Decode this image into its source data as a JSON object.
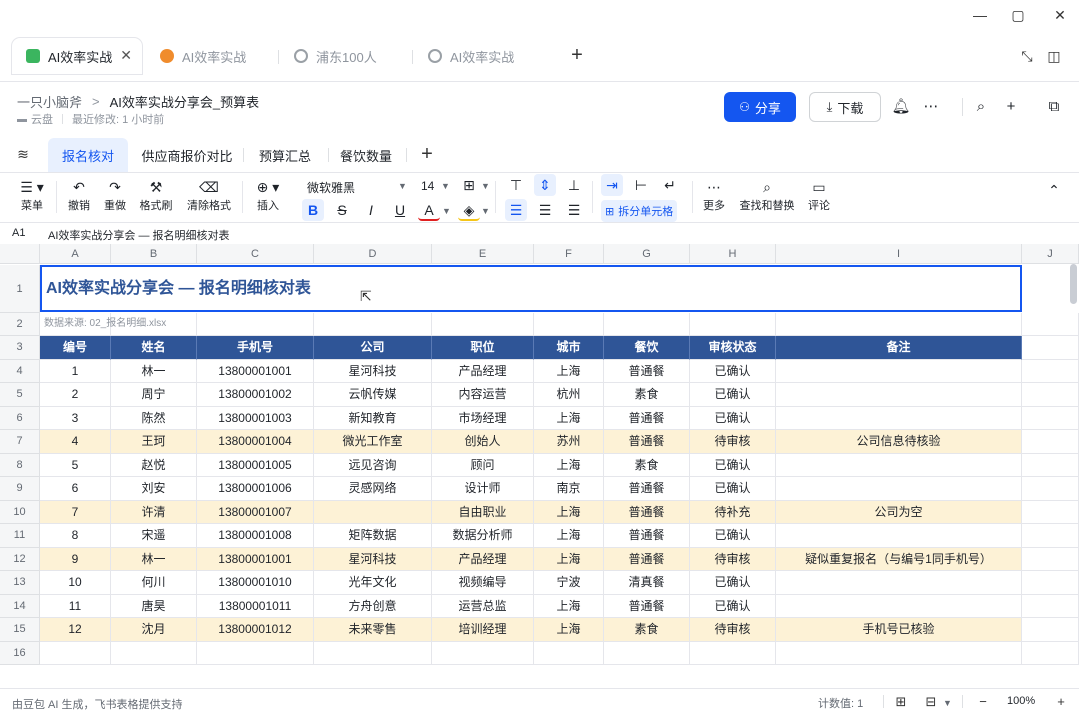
{
  "window": {
    "minimize_icon": "—",
    "maximize_icon": "▢",
    "close_icon": "✕"
  },
  "browser_tabs": [
    {
      "label": "AI效率实战",
      "active": true,
      "color": "#3bb55f"
    },
    {
      "label": "AI效率实战",
      "active": false,
      "color": "#f08c2d"
    },
    {
      "label": "浦东100人",
      "active": false,
      "color": "#9aa0a6"
    },
    {
      "label": "AI效率实战",
      "active": false,
      "color": "#9aa0a6"
    }
  ],
  "breadcrumb": {
    "parent": "一只小脑斧",
    "separator": ">",
    "title": "AI效率实战分享会_预算表"
  },
  "doc_meta": {
    "location": "云盘",
    "modified": "最近修改: 1 小时前"
  },
  "header": {
    "share_label": "分享",
    "download_label": "下载"
  },
  "sheet_tabs": [
    {
      "label": "报名核对",
      "active": true
    },
    {
      "label": "供应商报价对比",
      "active": false
    },
    {
      "label": "预算汇总",
      "active": false
    },
    {
      "label": "餐饮数量",
      "active": false
    }
  ],
  "toolbar": {
    "menu": "菜单",
    "undo": "撤销",
    "redo": "重做",
    "format_painter": "格式刷",
    "clear_format": "清除格式",
    "insert": "插入",
    "font_name": "微软雅黑",
    "font_size": "14",
    "unmerge": "拆分单元格",
    "more": "更多",
    "find_replace": "查找和替换",
    "comment": "评论"
  },
  "formula_bar": {
    "cell_ref": "A1",
    "content": "AI效率实战分享会 — 报名明细核对表"
  },
  "columns": [
    "A",
    "B",
    "C",
    "D",
    "E",
    "F",
    "G",
    "H",
    "I",
    "J"
  ],
  "sheet": {
    "title": "AI效率实战分享会 — 报名明细核对表",
    "source": "数据来源: 02_报名明细.xlsx",
    "headers": [
      "编号",
      "姓名",
      "手机号",
      "公司",
      "职位",
      "城市",
      "餐饮",
      "审核状态",
      "备注"
    ],
    "rows": [
      [
        "1",
        "林一",
        "13800001001",
        "星河科技",
        "产品经理",
        "上海",
        "普通餐",
        "已确认",
        ""
      ],
      [
        "2",
        "周宁",
        "13800001002",
        "云帆传媒",
        "内容运营",
        "杭州",
        "素食",
        "已确认",
        ""
      ],
      [
        "3",
        "陈然",
        "13800001003",
        "新知教育",
        "市场经理",
        "上海",
        "普通餐",
        "已确认",
        ""
      ],
      [
        "4",
        "王珂",
        "13800001004",
        "微光工作室",
        "创始人",
        "苏州",
        "普通餐",
        "待审核",
        "公司信息待核验"
      ],
      [
        "5",
        "赵悦",
        "13800001005",
        "远见咨询",
        "顾问",
        "上海",
        "素食",
        "已确认",
        ""
      ],
      [
        "6",
        "刘安",
        "13800001006",
        "灵感网络",
        "设计师",
        "南京",
        "普通餐",
        "已确认",
        ""
      ],
      [
        "7",
        "许清",
        "13800001007",
        "",
        "自由职业",
        "上海",
        "普通餐",
        "待补充",
        "公司为空"
      ],
      [
        "8",
        "宋遥",
        "13800001008",
        "矩阵数据",
        "数据分析师",
        "上海",
        "普通餐",
        "已确认",
        ""
      ],
      [
        "9",
        "林一",
        "13800001001",
        "星河科技",
        "产品经理",
        "上海",
        "普通餐",
        "待审核",
        "疑似重复报名（与编号1同手机号）"
      ],
      [
        "10",
        "何川",
        "13800001010",
        "光年文化",
        "视频编导",
        "宁波",
        "清真餐",
        "已确认",
        ""
      ],
      [
        "11",
        "唐昊",
        "13800001011",
        "方舟创意",
        "运营总监",
        "上海",
        "普通餐",
        "已确认",
        ""
      ],
      [
        "12",
        "沈月",
        "13800001012",
        "未来零售",
        "培训经理",
        "上海",
        "素食",
        "待审核",
        "手机号已核验"
      ]
    ],
    "highlight_rows": [
      3,
      6,
      8,
      11
    ],
    "row_numbers": [
      "1",
      "2",
      "3",
      "4",
      "5",
      "6",
      "7",
      "8",
      "9",
      "10",
      "11",
      "12",
      "13",
      "14",
      "15",
      "16"
    ]
  },
  "status": {
    "credit": "由豆包 AI 生成，飞书表格提供支持",
    "count": "计数值: 1",
    "zoom": "100%"
  },
  "colors": {
    "accent": "#1456f0",
    "header_fill": "#2f5597",
    "highlight_fill": "#fdf2d6"
  }
}
